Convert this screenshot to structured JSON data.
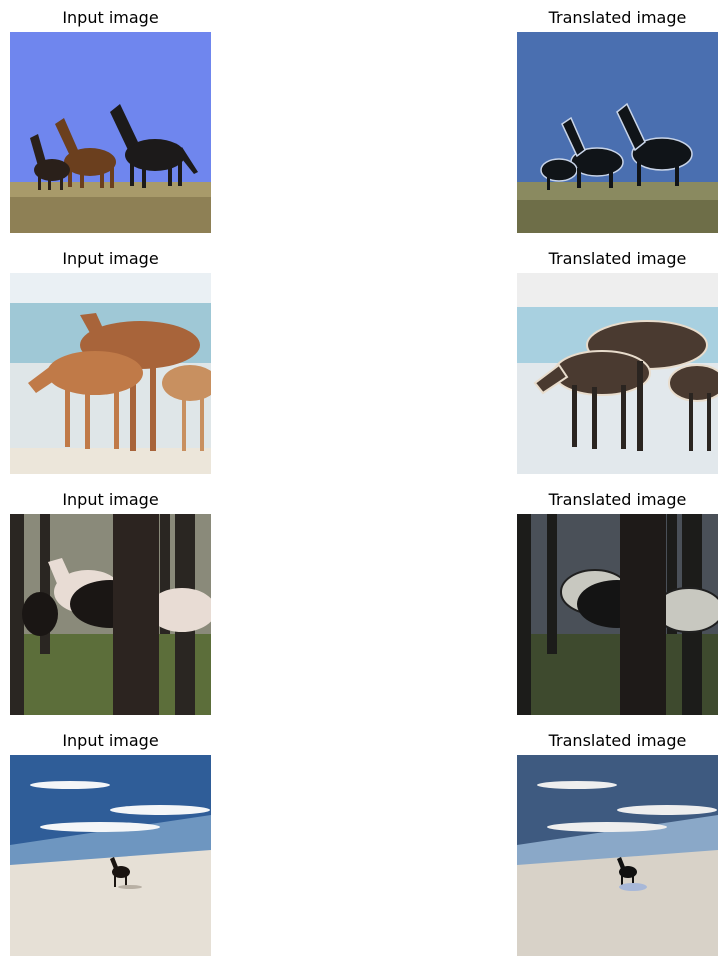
{
  "rows": [
    {
      "input_title": "Input image",
      "output_title": "Translated image",
      "scene": "horses-running-on-hill"
    },
    {
      "input_title": "Input image",
      "output_title": "Translated image",
      "scene": "horses-on-beach"
    },
    {
      "input_title": "Input image",
      "output_title": "Translated image",
      "scene": "horses-in-forest"
    },
    {
      "input_title": "Input image",
      "output_title": "Translated image",
      "scene": "horse-on-sandy-shore"
    }
  ],
  "colors": {
    "sky_blue": "#6f86ee",
    "grass": "#a89a6a",
    "sand": "#e8e2d8",
    "sea": "#3a6aa8",
    "horse_brown": "#8a5a32",
    "horse_dark": "#1a1a1a"
  }
}
